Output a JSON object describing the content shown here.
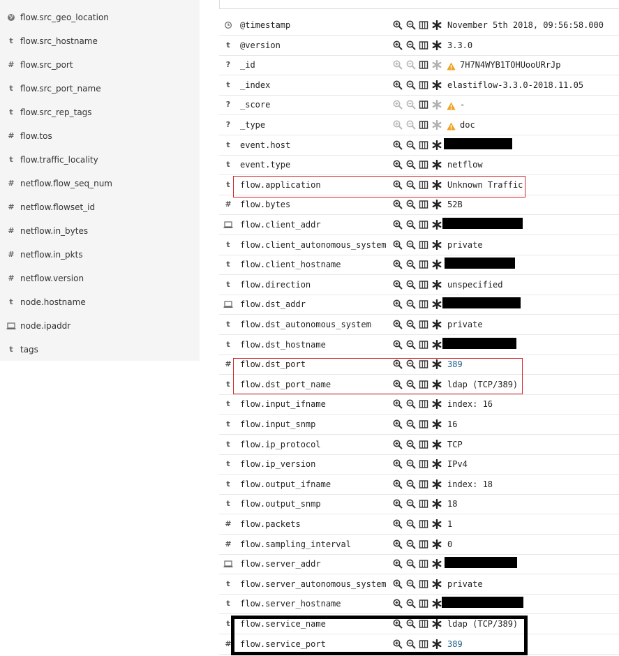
{
  "sidebar": {
    "items": [
      {
        "type": "geo",
        "label": "flow.src_geo_location"
      },
      {
        "type": "t",
        "label": "flow.src_hostname"
      },
      {
        "type": "#",
        "label": "flow.src_port"
      },
      {
        "type": "t",
        "label": "flow.src_port_name"
      },
      {
        "type": "t",
        "label": "flow.src_rep_tags"
      },
      {
        "type": "#",
        "label": "flow.tos"
      },
      {
        "type": "t",
        "label": "flow.traffic_locality"
      },
      {
        "type": "#",
        "label": "netflow.flow_seq_num"
      },
      {
        "type": "#",
        "label": "netflow.flowset_id"
      },
      {
        "type": "#",
        "label": "netflow.in_bytes"
      },
      {
        "type": "#",
        "label": "netflow.in_pkts"
      },
      {
        "type": "#",
        "label": "netflow.version"
      },
      {
        "type": "t",
        "label": "node.hostname"
      },
      {
        "type": "ip",
        "label": "node.ipaddr"
      },
      {
        "type": "t",
        "label": "tags"
      }
    ]
  },
  "document": {
    "fields": [
      {
        "type": "clock",
        "name": "@timestamp",
        "value": "November 5th 2018, 09:56:58.000"
      },
      {
        "type": "t",
        "name": "@version",
        "value": "3.3.0"
      },
      {
        "type": "?",
        "name": "_id",
        "value": "7H7N4WYB1TOHUooURrJp",
        "disabled": true,
        "warning": true
      },
      {
        "type": "t",
        "name": "_index",
        "value": "elastiflow-3.3.0-2018.11.05"
      },
      {
        "type": "?",
        "name": "_score",
        "value": "-",
        "disabled": true,
        "warning": true
      },
      {
        "type": "?",
        "name": "_type",
        "value": "doc",
        "disabled": true,
        "warning": true
      },
      {
        "type": "t",
        "name": "event.host",
        "value": "",
        "redacted": true
      },
      {
        "type": "t",
        "name": "event.type",
        "value": "netflow"
      },
      {
        "type": "t",
        "name": "flow.application",
        "value": "Unknown Traffic"
      },
      {
        "type": "#",
        "name": "flow.bytes",
        "value": "52B"
      },
      {
        "type": "ip",
        "name": "flow.client_addr",
        "value": "",
        "redacted": true
      },
      {
        "type": "t",
        "name": "flow.client_autonomous_system",
        "value": "private"
      },
      {
        "type": "t",
        "name": "flow.client_hostname",
        "value": "",
        "redacted": true
      },
      {
        "type": "t",
        "name": "flow.direction",
        "value": "unspecified"
      },
      {
        "type": "ip",
        "name": "flow.dst_addr",
        "value": "",
        "redacted": true
      },
      {
        "type": "t",
        "name": "flow.dst_autonomous_system",
        "value": "private"
      },
      {
        "type": "t",
        "name": "flow.dst_hostname",
        "value": "",
        "redacted": true
      },
      {
        "type": "#",
        "name": "flow.dst_port",
        "value": "389",
        "numeric": true
      },
      {
        "type": "t",
        "name": "flow.dst_port_name",
        "value": "ldap (TCP/389)"
      },
      {
        "type": "t",
        "name": "flow.input_ifname",
        "value": "index: 16"
      },
      {
        "type": "t",
        "name": "flow.input_snmp",
        "value": "16"
      },
      {
        "type": "t",
        "name": "flow.ip_protocol",
        "value": "TCP"
      },
      {
        "type": "t",
        "name": "flow.ip_version",
        "value": "IPv4"
      },
      {
        "type": "t",
        "name": "flow.output_ifname",
        "value": "index: 18"
      },
      {
        "type": "t",
        "name": "flow.output_snmp",
        "value": "18"
      },
      {
        "type": "#",
        "name": "flow.packets",
        "value": "1"
      },
      {
        "type": "#",
        "name": "flow.sampling_interval",
        "value": "0"
      },
      {
        "type": "ip",
        "name": "flow.server_addr",
        "value": "",
        "redacted": true
      },
      {
        "type": "t",
        "name": "flow.server_autonomous_system",
        "value": "private"
      },
      {
        "type": "t",
        "name": "flow.server_hostname",
        "value": "",
        "redacted": true
      },
      {
        "type": "t",
        "name": "flow.service_name",
        "value": "ldap (TCP/389)"
      },
      {
        "type": "#",
        "name": "flow.service_port",
        "value": "389",
        "numeric": true
      }
    ]
  },
  "icons": {
    "filter_for": "zoom-in-icon",
    "filter_out": "zoom-out-icon",
    "toggle_column": "columns-icon",
    "filter_exists": "asterisk-icon",
    "warning": "warning-icon",
    "geo": "globe-icon",
    "ip": "laptop-icon",
    "clock": "clock-icon"
  },
  "colors": {
    "highlight_red": "#d0242b",
    "highlight_black": "#000000",
    "numeric_value": "#1a5f8a",
    "warning": "#f0a11a"
  }
}
